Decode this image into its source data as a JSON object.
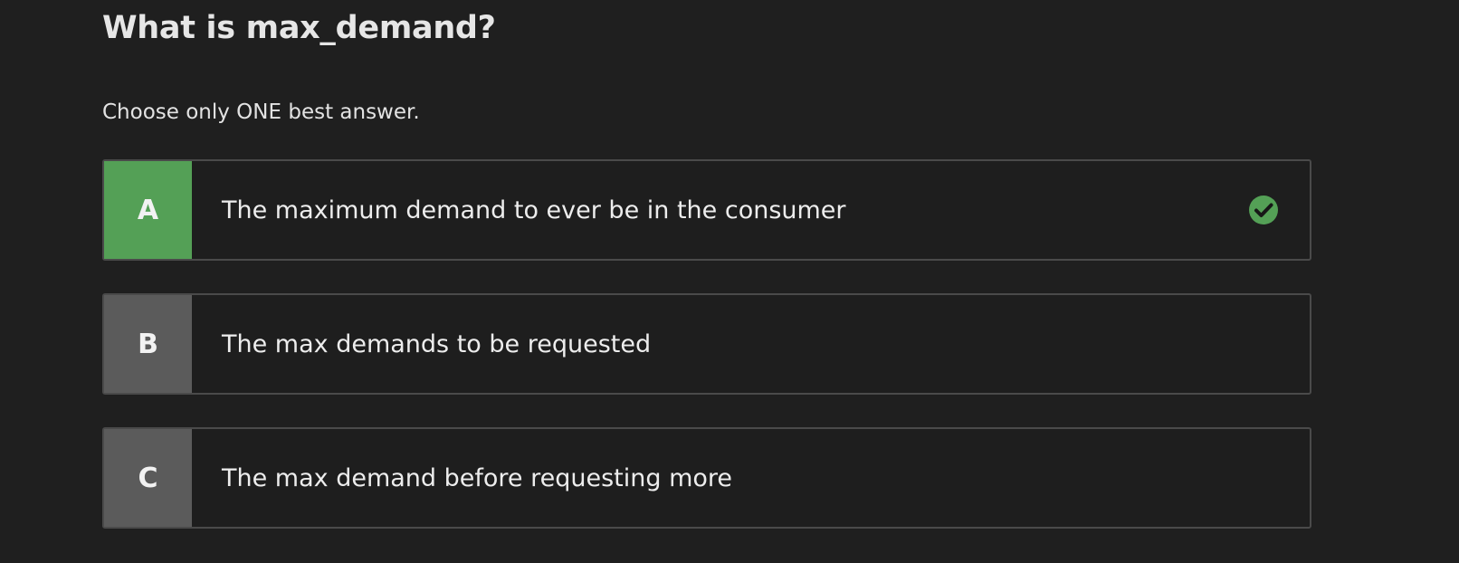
{
  "question": {
    "title": "What is max_demand?",
    "instruction": "Choose only ONE best answer."
  },
  "options": [
    {
      "letter": "A",
      "text": "The maximum demand to ever be in the consumer",
      "selected": true,
      "color": "#54a056"
    },
    {
      "letter": "B",
      "text": "The max demands to be requested",
      "selected": false,
      "color": "#5b5b5b"
    },
    {
      "letter": "C",
      "text": "The max demand before requesting more",
      "selected": false,
      "color": "#5b5b5b"
    }
  ],
  "icons": {
    "selected": "check-circle-icon"
  },
  "colors": {
    "selected_accent": "#54a056",
    "unselected_letter_bg": "#5b5b5b",
    "background": "#1f1f1f"
  }
}
